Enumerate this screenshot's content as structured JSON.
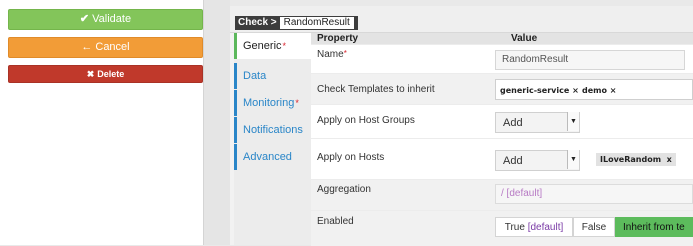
{
  "actions": {
    "validate_label": "Validate",
    "cancel_label": "Cancel",
    "delete_label": "Delete"
  },
  "breadcrumb": {
    "prefix": "Check >",
    "current": "RandomResult"
  },
  "tabs": [
    {
      "label": "Generic",
      "required": true,
      "active": true
    },
    {
      "label": "Data",
      "required": false
    },
    {
      "label": "Monitoring",
      "required": true
    },
    {
      "label": "Notifications",
      "required": false
    },
    {
      "label": "Advanced",
      "required": false
    }
  ],
  "table": {
    "col_property": "Property",
    "col_value": "Value"
  },
  "properties": {
    "name": {
      "label": "Name",
      "required_mark": "*",
      "value": "RandomResult"
    },
    "templates": {
      "label": "Check Templates to inherit",
      "tags": [
        "generic-service",
        "demo"
      ],
      "tag_remove": "×"
    },
    "host_groups": {
      "label": "Apply on Host Groups",
      "select_value": "Add"
    },
    "hosts": {
      "label": "Apply on Hosts",
      "select_value": "Add",
      "tag": "ILoveRandom",
      "tag_remove": "x"
    },
    "aggregation": {
      "label": "Aggregation",
      "placeholder": "/ [default]"
    },
    "enabled": {
      "label": "Enabled",
      "option_true": "True",
      "option_true_default": "[default]",
      "option_false": "False",
      "option_inherit": "Inherit from te"
    }
  },
  "colors": {
    "validate": "#83c55a",
    "cancel": "#f29c37",
    "delete": "#c0392b",
    "accent": "#2a86c8",
    "inherit_active": "#5cbb5c"
  },
  "icons": {
    "validate": "check-icon",
    "cancel": "arrow-left-icon",
    "delete": "x-icon",
    "select": "caret-down-icon"
  }
}
